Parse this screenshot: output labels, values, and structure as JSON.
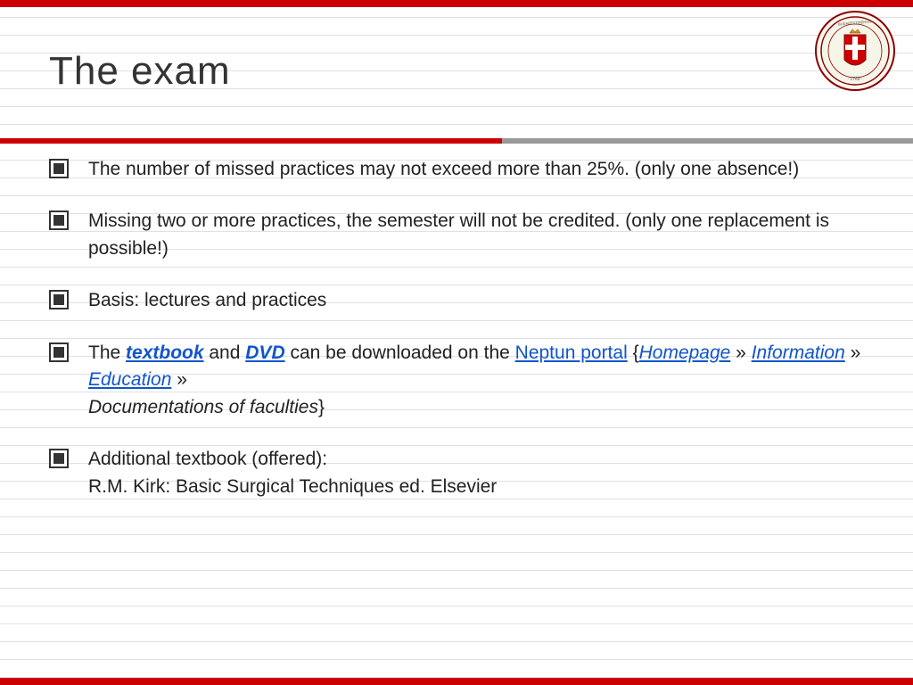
{
  "slide": {
    "title": "The exam",
    "logo_alt": "Semmelweis University Budapest crest"
  },
  "bullets": [
    {
      "id": "bullet-1",
      "text": "The number of missed practices may not exceed more than 25%. (only one absence!)"
    },
    {
      "id": "bullet-2",
      "text": "Missing two or more practices, the semester will not be credited. (only one replacement is possible!)"
    },
    {
      "id": "bullet-3",
      "text": "Basis: lectures and practices"
    },
    {
      "id": "bullet-4",
      "parts": [
        {
          "type": "text",
          "content": "The "
        },
        {
          "type": "bold-link",
          "content": "textbook",
          "href": "#"
        },
        {
          "type": "text",
          "content": " and "
        },
        {
          "type": "bold-link",
          "content": "DVD",
          "href": "#"
        },
        {
          "type": "text",
          "content": " can be downloaded on the "
        },
        {
          "type": "link",
          "content": "Neptun portal",
          "href": "#"
        },
        {
          "type": "text",
          "content": " {"
        },
        {
          "type": "italic-link",
          "content": "Homepage",
          "href": "#"
        },
        {
          "type": "text",
          "content": " » "
        },
        {
          "type": "italic-link",
          "content": "Information",
          "href": "#"
        },
        {
          "type": "text",
          "content": " » "
        },
        {
          "type": "italic-link",
          "content": "Education",
          "href": "#"
        },
        {
          "type": "text",
          "content": " » "
        },
        {
          "type": "italic-text",
          "content": "Documentations of faculties"
        },
        {
          "type": "text",
          "content": "}"
        }
      ]
    },
    {
      "id": "bullet-5",
      "text": "Additional textbook (offered):\nR.M. Kirk: Basic Surgical Techniques ed. Elsevier"
    }
  ]
}
